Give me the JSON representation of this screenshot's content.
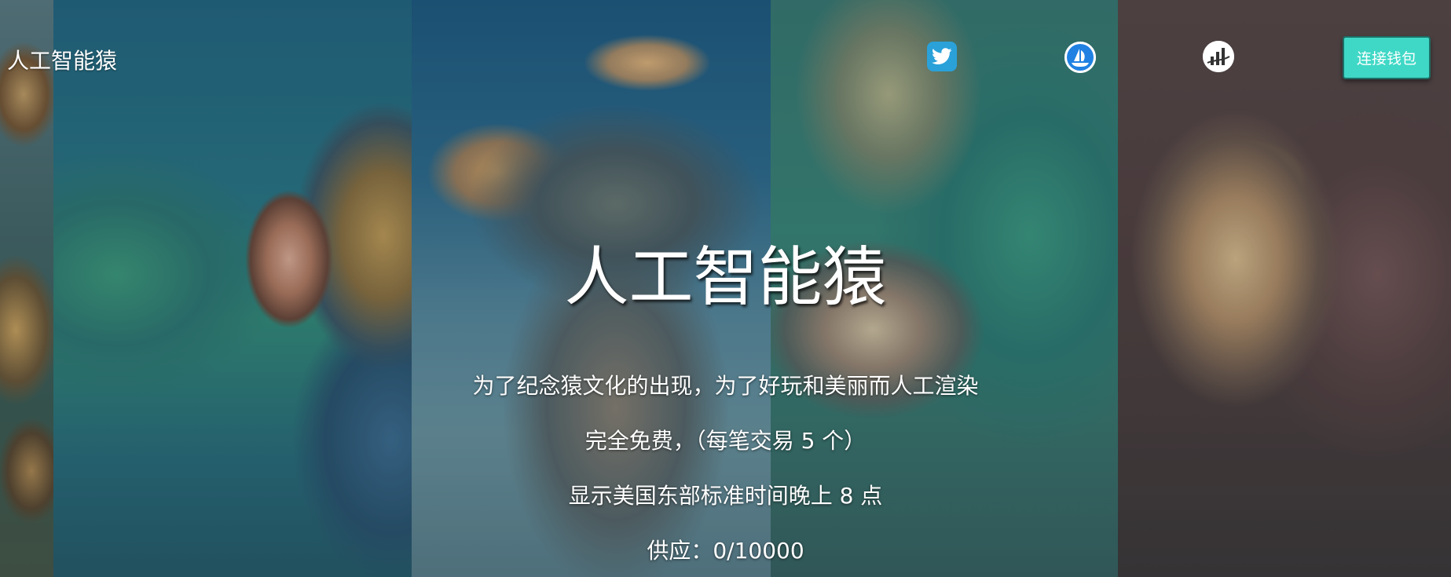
{
  "header": {
    "brand": "人工智能猿",
    "connect_button": "连接钱包",
    "icons": {
      "twitter": "twitter-icon",
      "opensea": "opensea-icon",
      "chart": "chart-icon"
    }
  },
  "hero": {
    "title": "人工智能猿",
    "description": "为了纪念猿文化的出现，为了好玩和美丽而人工渲染",
    "pricing": "完全免费，（每笔交易 5 个）",
    "reveal_time": "显示美国东部标准时间晚上 8 点",
    "supply": "供应：0/10000"
  },
  "colors": {
    "accent": "#3fd8c6",
    "twitter": "#2aa1d9",
    "text": "#ffffff"
  }
}
